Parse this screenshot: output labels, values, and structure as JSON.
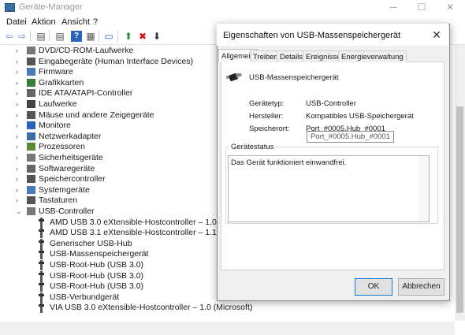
{
  "app": {
    "title": "Geräte-Manager",
    "icon": "device-manager-icon"
  },
  "window_controls": {
    "minimize": "─",
    "maximize": "☐",
    "close": "✕"
  },
  "menu": {
    "items": [
      "Datei",
      "Aktion",
      "Ansicht",
      "?"
    ]
  },
  "toolbar": {
    "icons": [
      "back-arrow-icon",
      "forward-arrow-icon",
      "properties-icon",
      "help-icon",
      "details-icon",
      "monitor-icon",
      "update-driver-icon",
      "uninstall-icon",
      "download-icon"
    ],
    "glyphs": {
      "back": "⇦",
      "forward": "⇨",
      "props": "▤",
      "help": "?",
      "details": "▦",
      "monitor": "▭",
      "update": "⬆",
      "remove": "✖",
      "down": "⬇"
    }
  },
  "tree": {
    "collapsed_glyph": "›",
    "expanded_glyph": "⌄",
    "categories": [
      {
        "label": "DVD/CD-ROM-Laufwerke"
      },
      {
        "label": "Eingabegeräte (Human Interface Devices)"
      },
      {
        "label": "Firmware"
      },
      {
        "label": "Grafikkarten"
      },
      {
        "label": "IDE ATA/ATAPI-Controller"
      },
      {
        "label": "Laufwerke"
      },
      {
        "label": "Mäuse und andere Zeigegeräte"
      },
      {
        "label": "Monitore"
      },
      {
        "label": "Netzwerkadapter"
      },
      {
        "label": "Prozessoren"
      },
      {
        "label": "Sicherheitsgeräte"
      },
      {
        "label": "Softwaregeräte"
      },
      {
        "label": "Speichercontroller"
      },
      {
        "label": "Systemgeräte"
      },
      {
        "label": "Tastaturen"
      },
      {
        "label": "USB-Controller"
      }
    ],
    "usb_children": [
      "AMD USB 3.0 eXtensible-Hostcontroller – 1.0 (Micros",
      "AMD USB 3.1 eXtensible-Hostcontroller – 1.10 (Micr",
      "Generischer USB-Hub",
      "USB-Massenspeichergerät",
      "USB-Root-Hub (USB 3.0)",
      "USB-Root-Hub (USB 3.0)",
      "USB-Root-Hub (USB 3.0)",
      "USB-Verbundgerät",
      "VIA USB 3.0 eXtensible-Hostcontroller – 1.0 (Microsoft)"
    ]
  },
  "dialog": {
    "title": "Eigenschaften von USB-Massenspeichergerät",
    "close": "✕",
    "tabs": [
      "Allgemein",
      "Treiber",
      "Details",
      "Ereignisse",
      "Energieverwaltung"
    ],
    "active_tab": "Allgemein",
    "device_name": "USB-Massenspeichergerät",
    "props": [
      {
        "label": "Gerätetyp:",
        "value": "USB-Controller"
      },
      {
        "label": "Hersteller:",
        "value": "Kompatibles USB-Speichergerät"
      },
      {
        "label": "Speicherort:",
        "value": "Port_#0005.Hub_#0001"
      }
    ],
    "tooltip": "Port_#0005.Hub_#0001",
    "status_legend": "Gerätestatus",
    "status_text": "Das Gerät funktioniert einwandfrei.",
    "ok": "OK",
    "cancel": "Abbrechen"
  }
}
